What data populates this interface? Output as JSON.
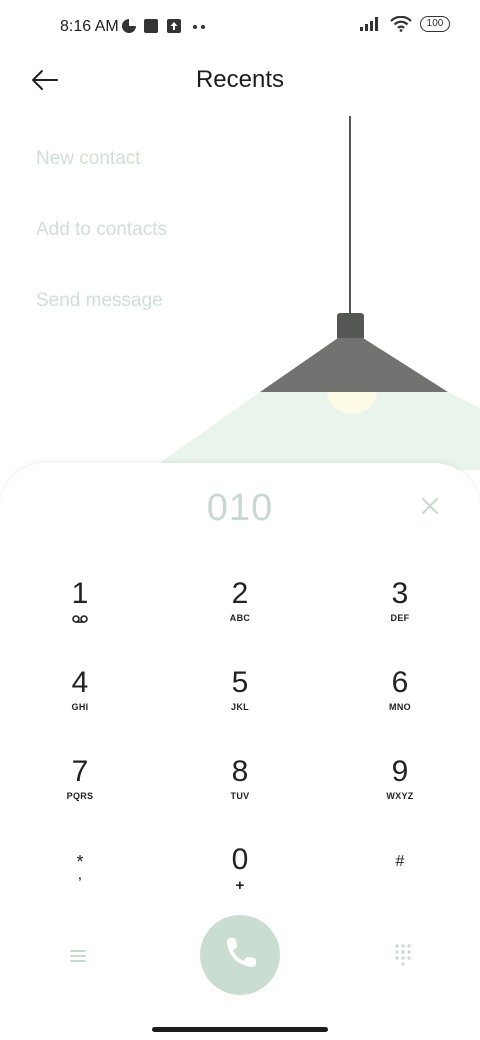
{
  "status_bar": {
    "time": "8:16 AM",
    "battery": "100",
    "icons": [
      "pie-chart-icon",
      "square-icon",
      "upload-icon",
      "more-dots-icon",
      "signal-icon",
      "wifi-icon",
      "battery-icon"
    ]
  },
  "header": {
    "title": "Recents",
    "back_icon": "back-arrow-icon"
  },
  "menu": {
    "items": [
      {
        "label": "New contact"
      },
      {
        "label": "Add to contacts"
      },
      {
        "label": "Send message"
      }
    ]
  },
  "dialer": {
    "number": "010",
    "keys": [
      {
        "digit": "1",
        "letters": ""
      },
      {
        "digit": "2",
        "letters": "ABC"
      },
      {
        "digit": "3",
        "letters": "DEF"
      },
      {
        "digit": "4",
        "letters": "GHI"
      },
      {
        "digit": "5",
        "letters": "JKL"
      },
      {
        "digit": "6",
        "letters": "MNO"
      },
      {
        "digit": "7",
        "letters": "PQRS"
      },
      {
        "digit": "8",
        "letters": "TUV"
      },
      {
        "digit": "9",
        "letters": "WXYZ"
      },
      {
        "digit": "*",
        "letters": ","
      },
      {
        "digit": "0",
        "letters": "+"
      },
      {
        "digit": "#",
        "letters": ""
      }
    ]
  },
  "colors": {
    "accent_muted": "#c9ddd1",
    "menu_text": "#cfe0d6",
    "lamp_shade": "#727370"
  }
}
